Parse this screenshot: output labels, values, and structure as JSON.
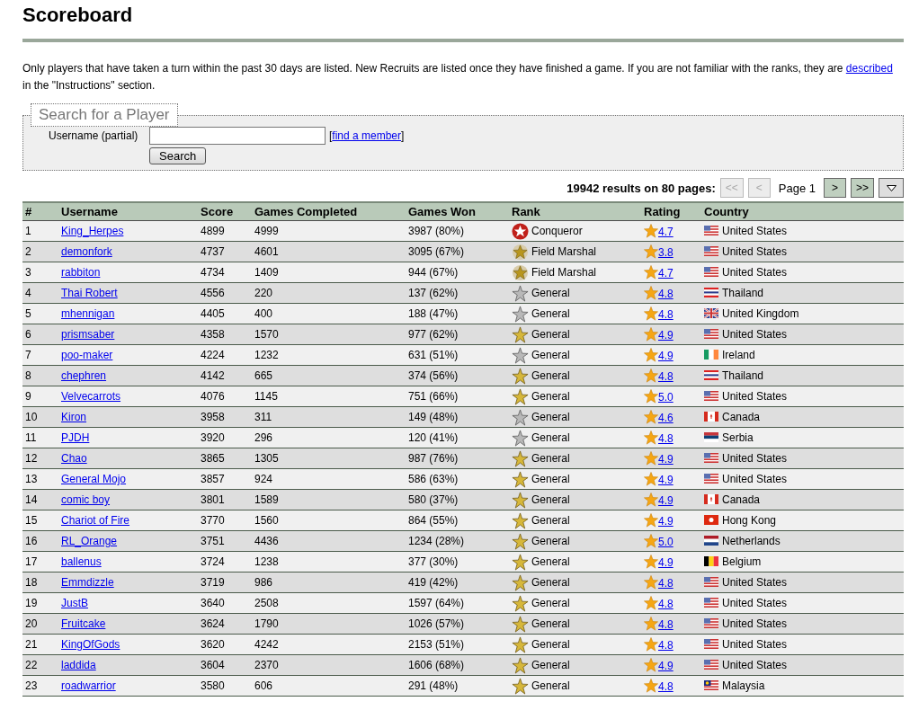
{
  "title": "Scoreboard",
  "intro": {
    "before": "Only players that have taken a turn within the past 30 days are listed. New Recruits are listed once they have finished a game. If you are not familiar with the ranks, they are",
    "link": "described",
    "after": "in the \"Instructions\" section."
  },
  "search": {
    "legend": "Search for a Player",
    "label": "Username (partial)",
    "bracket_open": "[",
    "link": "find a member",
    "bracket_close": "]",
    "button": "Search"
  },
  "pagination": {
    "summary": "19942 results on 80 pages:",
    "buttons": [
      {
        "label": "<<",
        "disabled": true
      },
      {
        "label": "<",
        "disabled": true
      }
    ],
    "page": "Page 1",
    "next_buttons": [
      {
        "label": ">",
        "disabled": false
      },
      {
        "label": ">>",
        "disabled": false
      }
    ]
  },
  "table": {
    "columns": [
      "#",
      "Username",
      "Score",
      "Games Completed",
      "Games Won",
      "Rank",
      "Rating",
      "Country"
    ],
    "rows": [
      {
        "num": "1",
        "username": "King_Herpes",
        "score": "4899",
        "completed": "4999",
        "won": "3987 (80%)",
        "rank_badge": {
          "kind": "conqueror"
        },
        "rank": "Conqueror",
        "rating": "4.7",
        "flag": {
          "kind": "us"
        },
        "country": "United States"
      },
      {
        "num": "2",
        "username": "demonfork",
        "score": "4737",
        "completed": "4601",
        "won": "3095 (67%)",
        "rank_badge": {
          "kind": "marshal"
        },
        "rank": "Field Marshal",
        "rating": "3.8",
        "flag": {
          "kind": "us"
        },
        "country": "United States"
      },
      {
        "num": "3",
        "username": "rabbiton",
        "score": "4734",
        "completed": "1409",
        "won": "944 (67%)",
        "rank_badge": {
          "kind": "marshal"
        },
        "rank": "Field Marshal",
        "rating": "4.7",
        "flag": {
          "kind": "us"
        },
        "country": "United States"
      },
      {
        "num": "4",
        "username": "Thai Robert",
        "score": "4556",
        "completed": "220",
        "won": "137 (62%)",
        "rank_badge": {
          "kind": "silver"
        },
        "rank": "General",
        "rating": "4.8",
        "flag": {
          "kind": "th"
        },
        "country": "Thailand"
      },
      {
        "num": "5",
        "username": "mhennigan",
        "score": "4405",
        "completed": "400",
        "won": "188 (47%)",
        "rank_badge": {
          "kind": "silver"
        },
        "rank": "General",
        "rating": "4.8",
        "flag": {
          "kind": "gb"
        },
        "country": "United Kingdom"
      },
      {
        "num": "6",
        "username": "prismsaber",
        "score": "4358",
        "completed": "1570",
        "won": "977 (62%)",
        "rank_badge": {
          "kind": "gold"
        },
        "rank": "General",
        "rating": "4.9",
        "flag": {
          "kind": "us"
        },
        "country": "United States"
      },
      {
        "num": "7",
        "username": "poo-maker",
        "score": "4224",
        "completed": "1232",
        "won": "631 (51%)",
        "rank_badge": {
          "kind": "silver"
        },
        "rank": "General",
        "rating": "4.9",
        "flag": {
          "kind": "ie"
        },
        "country": "Ireland"
      },
      {
        "num": "8",
        "username": "chephren",
        "score": "4142",
        "completed": "665",
        "won": "374 (56%)",
        "rank_badge": {
          "kind": "gold"
        },
        "rank": "General",
        "rating": "4.8",
        "flag": {
          "kind": "th"
        },
        "country": "Thailand"
      },
      {
        "num": "9",
        "username": "Velvecarrots",
        "score": "4076",
        "completed": "1145",
        "won": "751 (66%)",
        "rank_badge": {
          "kind": "gold"
        },
        "rank": "General",
        "rating": "5.0",
        "flag": {
          "kind": "us"
        },
        "country": "United States"
      },
      {
        "num": "10",
        "username": "Kiron",
        "score": "3958",
        "completed": "311",
        "won": "149 (48%)",
        "rank_badge": {
          "kind": "silver"
        },
        "rank": "General",
        "rating": "4.6",
        "flag": {
          "kind": "ca"
        },
        "country": "Canada"
      },
      {
        "num": "11",
        "username": "PJDH",
        "score": "3920",
        "completed": "296",
        "won": "120 (41%)",
        "rank_badge": {
          "kind": "silver"
        },
        "rank": "General",
        "rating": "4.8",
        "flag": {
          "kind": "rs"
        },
        "country": "Serbia"
      },
      {
        "num": "12",
        "username": "Chao",
        "score": "3865",
        "completed": "1305",
        "won": "987 (76%)",
        "rank_badge": {
          "kind": "gold"
        },
        "rank": "General",
        "rating": "4.9",
        "flag": {
          "kind": "us"
        },
        "country": "United States"
      },
      {
        "num": "13",
        "username": "General Mojo",
        "score": "3857",
        "completed": "924",
        "won": "586 (63%)",
        "rank_badge": {
          "kind": "gold"
        },
        "rank": "General",
        "rating": "4.9",
        "flag": {
          "kind": "us"
        },
        "country": "United States"
      },
      {
        "num": "14",
        "username": "comic boy",
        "score": "3801",
        "completed": "1589",
        "won": "580 (37%)",
        "rank_badge": {
          "kind": "gold"
        },
        "rank": "General",
        "rating": "4.9",
        "flag": {
          "kind": "ca"
        },
        "country": "Canada"
      },
      {
        "num": "15",
        "username": "Chariot of Fire",
        "score": "3770",
        "completed": "1560",
        "won": "864 (55%)",
        "rank_badge": {
          "kind": "gold"
        },
        "rank": "General",
        "rating": "4.9",
        "flag": {
          "kind": "hk"
        },
        "country": "Hong Kong"
      },
      {
        "num": "16",
        "username": "RL_Orange",
        "score": "3751",
        "completed": "4436",
        "won": "1234 (28%)",
        "rank_badge": {
          "kind": "gold"
        },
        "rank": "General",
        "rating": "5.0",
        "flag": {
          "kind": "nl"
        },
        "country": "Netherlands"
      },
      {
        "num": "17",
        "username": "ballenus",
        "score": "3724",
        "completed": "1238",
        "won": "377 (30%)",
        "rank_badge": {
          "kind": "gold"
        },
        "rank": "General",
        "rating": "4.9",
        "flag": {
          "kind": "be"
        },
        "country": "Belgium"
      },
      {
        "num": "18",
        "username": "Emmdizzle",
        "score": "3719",
        "completed": "986",
        "won": "419 (42%)",
        "rank_badge": {
          "kind": "gold"
        },
        "rank": "General",
        "rating": "4.8",
        "flag": {
          "kind": "us"
        },
        "country": "United States"
      },
      {
        "num": "19",
        "username": "JustB",
        "score": "3640",
        "completed": "2508",
        "won": "1597 (64%)",
        "rank_badge": {
          "kind": "gold"
        },
        "rank": "General",
        "rating": "4.8",
        "flag": {
          "kind": "us"
        },
        "country": "United States"
      },
      {
        "num": "20",
        "username": "Fruitcake",
        "score": "3624",
        "completed": "1790",
        "won": "1026 (57%)",
        "rank_badge": {
          "kind": "gold"
        },
        "rank": "General",
        "rating": "4.8",
        "flag": {
          "kind": "us"
        },
        "country": "United States"
      },
      {
        "num": "21",
        "username": "KingOfGods",
        "score": "3620",
        "completed": "4242",
        "won": "2153 (51%)",
        "rank_badge": {
          "kind": "gold"
        },
        "rank": "General",
        "rating": "4.8",
        "flag": {
          "kind": "us"
        },
        "country": "United States"
      },
      {
        "num": "22",
        "username": "laddida",
        "score": "3604",
        "completed": "2370",
        "won": "1606 (68%)",
        "rank_badge": {
          "kind": "gold"
        },
        "rank": "General",
        "rating": "4.9",
        "flag": {
          "kind": "us"
        },
        "country": "United States"
      },
      {
        "num": "23",
        "username": "roadwarrior",
        "score": "3580",
        "completed": "606",
        "won": "291 (48%)",
        "rank_badge": {
          "kind": "gold"
        },
        "rank": "General",
        "rating": "4.8",
        "flag": {
          "kind": "my"
        },
        "country": "Malaysia"
      }
    ]
  }
}
